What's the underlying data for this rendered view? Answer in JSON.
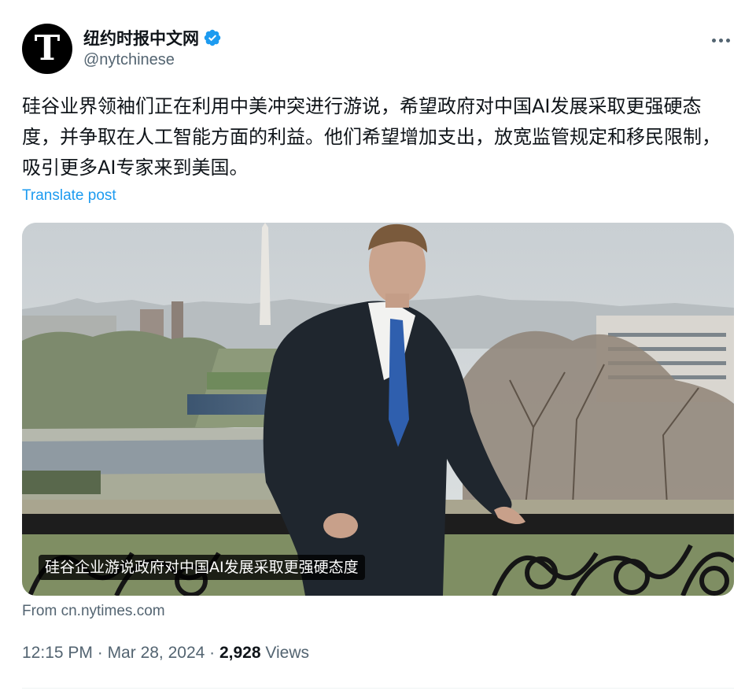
{
  "author": {
    "display_name": "纽约时报中文网",
    "handle": "@nytchinese",
    "avatar_letter": "T",
    "verified": true
  },
  "post": {
    "text": "硅谷业界领袖们正在利用中美冲突进行游说，希望政府对中国AI发展采取更强硬态度，并争取在人工智能方面的利益。他们希望增加支出，放宽监管规定和移民限制，吸引更多AI专家来到美国。",
    "translate_label": "Translate post"
  },
  "link_card": {
    "title": "硅谷企业游说政府对中国AI发展采取更强硬态度",
    "source": "From cn.nytimes.com"
  },
  "meta": {
    "time": "12:15 PM",
    "separator": " · ",
    "date": "Mar 28, 2024",
    "views_count": "2,928",
    "views_label": " Views"
  },
  "colors": {
    "accent": "#1d9bf0",
    "text_primary": "#0f1419",
    "text_secondary": "#536471"
  },
  "icons": [
    "verified-badge-icon",
    "more-options-icon"
  ]
}
